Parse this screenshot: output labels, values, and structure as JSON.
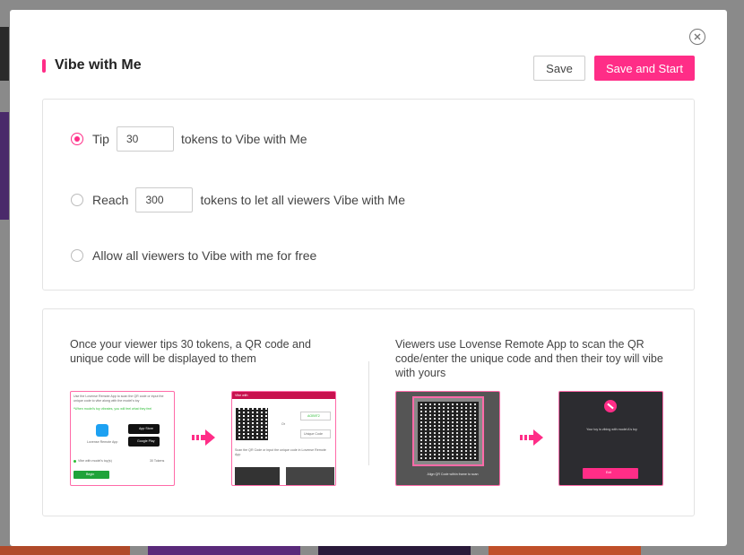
{
  "modal": {
    "title": "Vibe with Me",
    "save_label": "Save",
    "save_start_label": "Save and Start",
    "accent_color": "#ff2d87"
  },
  "options": [
    {
      "label": "Tip",
      "value": "30",
      "suffix": "tokens to Vibe with Me",
      "checked": true
    },
    {
      "label": "Reach",
      "value": "300",
      "suffix": "tokens to let all viewers Vibe with Me",
      "checked": false
    },
    {
      "label": "Allow all viewers to Vibe with me for free",
      "checked": false
    }
  ],
  "info": {
    "left_text": "Once your viewer tips 30 tokens, a QR code and unique code will be displayed to them",
    "right_text": "Viewers use Lovense Remote App to scan the QR code/enter the unique code and then their toy will vibe with yours",
    "thumb1": {
      "instructions": "Use the Lovense Remote App to scan the QR code or input the unique code to vibe along with the model's toy",
      "note": "*When model's toy vibrates, you will feel what they feel",
      "app_label": "Lovense Remote App",
      "app_store": "App Store",
      "google_play": "Google Play",
      "vibe_label": "Vibe with model's toy(s)",
      "tokens": "30 Tokens",
      "begin": "Begin"
    },
    "thumb2": {
      "header": "Vibe with",
      "or": "Or",
      "code": "AOB9T2",
      "unique_code": "Unique Code",
      "instructions": "Scan the QR Code or input the unique code in Lovense Remote App"
    },
    "thumb3": {
      "caption": "Align QR Code within frame to scan"
    },
    "thumb4": {
      "message": "Your toy is vibing with model A's toy",
      "exit": "Exit"
    }
  }
}
